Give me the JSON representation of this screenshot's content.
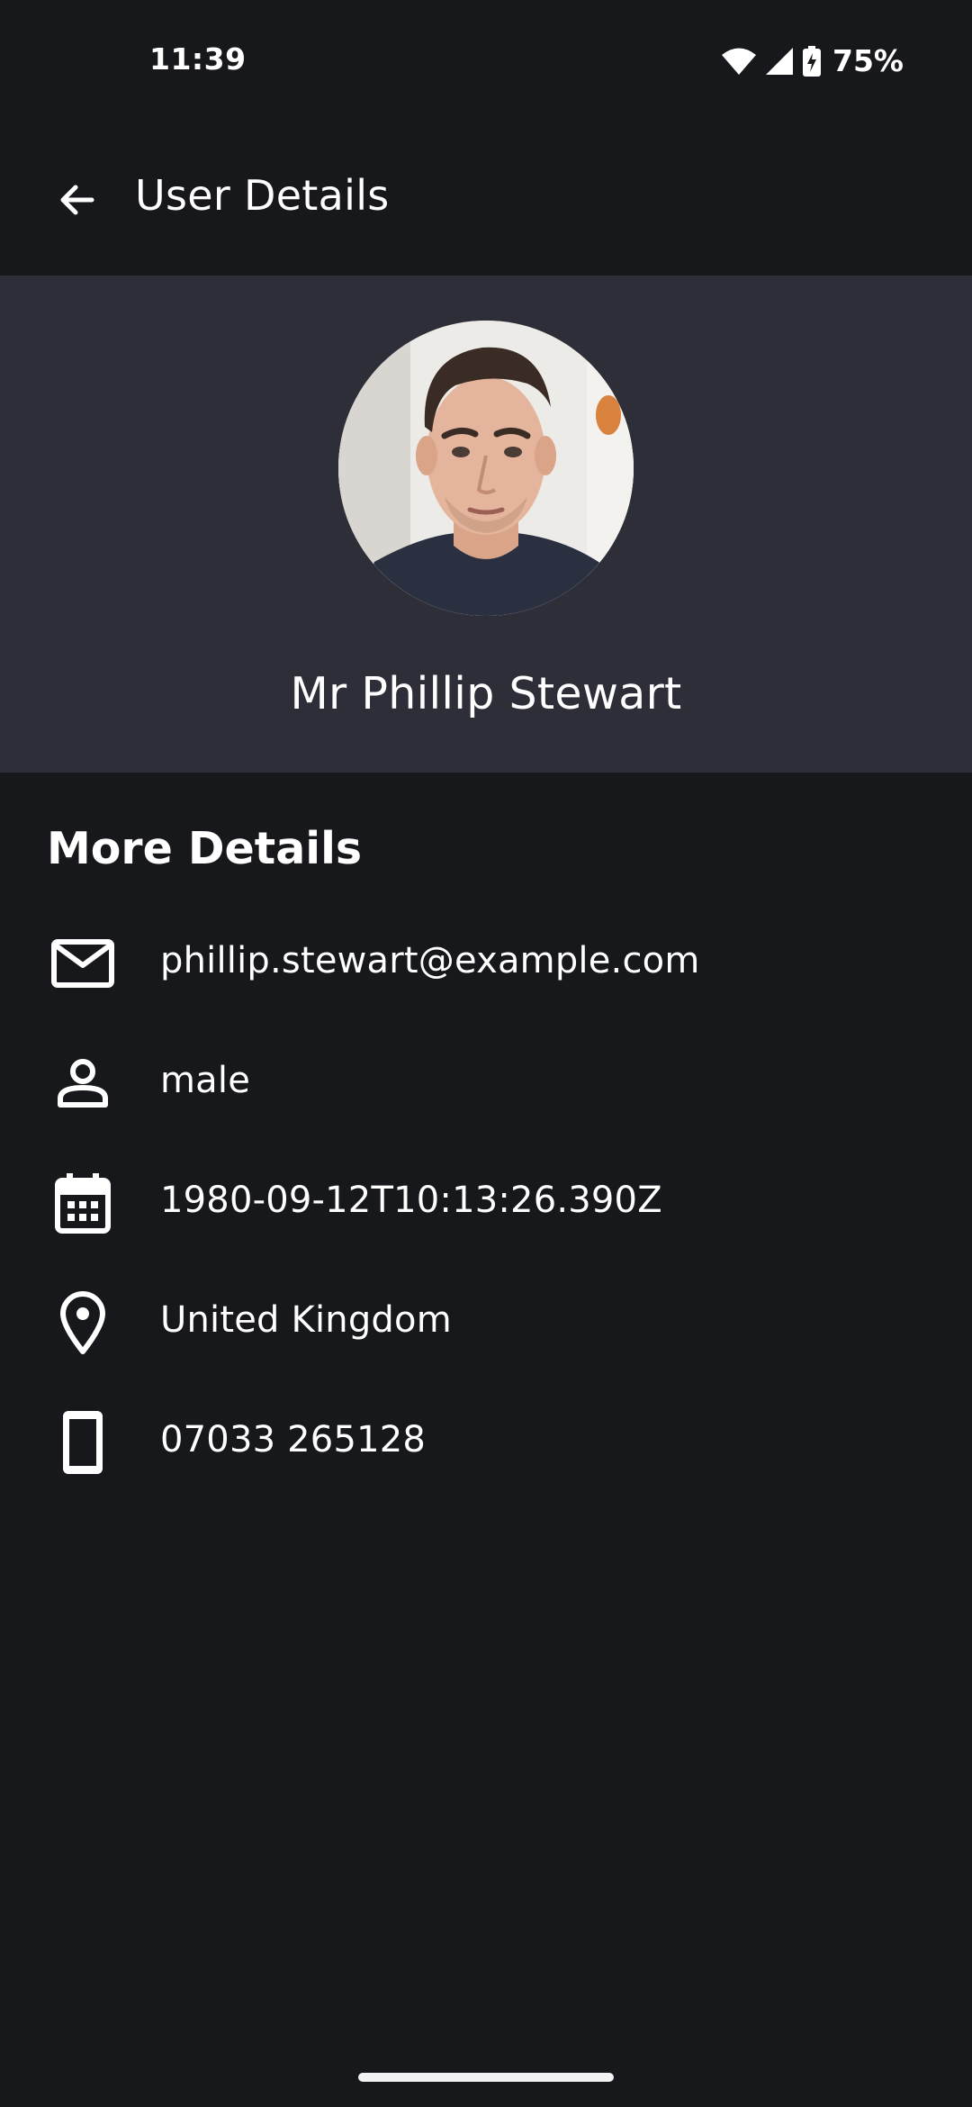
{
  "status_bar": {
    "time": "11:39",
    "battery": "75%",
    "icons": [
      "wifi-icon",
      "cellular-signal-icon",
      "battery-charging-icon"
    ]
  },
  "app_bar": {
    "title": "User Details",
    "back_icon": "arrow-back-icon"
  },
  "profile": {
    "name": "Mr Phillip Stewart",
    "header_color": "#2d2e37"
  },
  "details": {
    "title": "More Details",
    "items": [
      {
        "icon": "mail-icon",
        "value": "phillip.stewart@example.com"
      },
      {
        "icon": "person-icon",
        "value": "male"
      },
      {
        "icon": "calendar-icon",
        "value": "1980-09-12T10:13:26.390Z"
      },
      {
        "icon": "location-pin-icon",
        "value": "United Kingdom"
      },
      {
        "icon": "phone-icon",
        "value": "07033 265128"
      }
    ]
  },
  "colors": {
    "background": "#17181b",
    "text": "#ffffff"
  }
}
